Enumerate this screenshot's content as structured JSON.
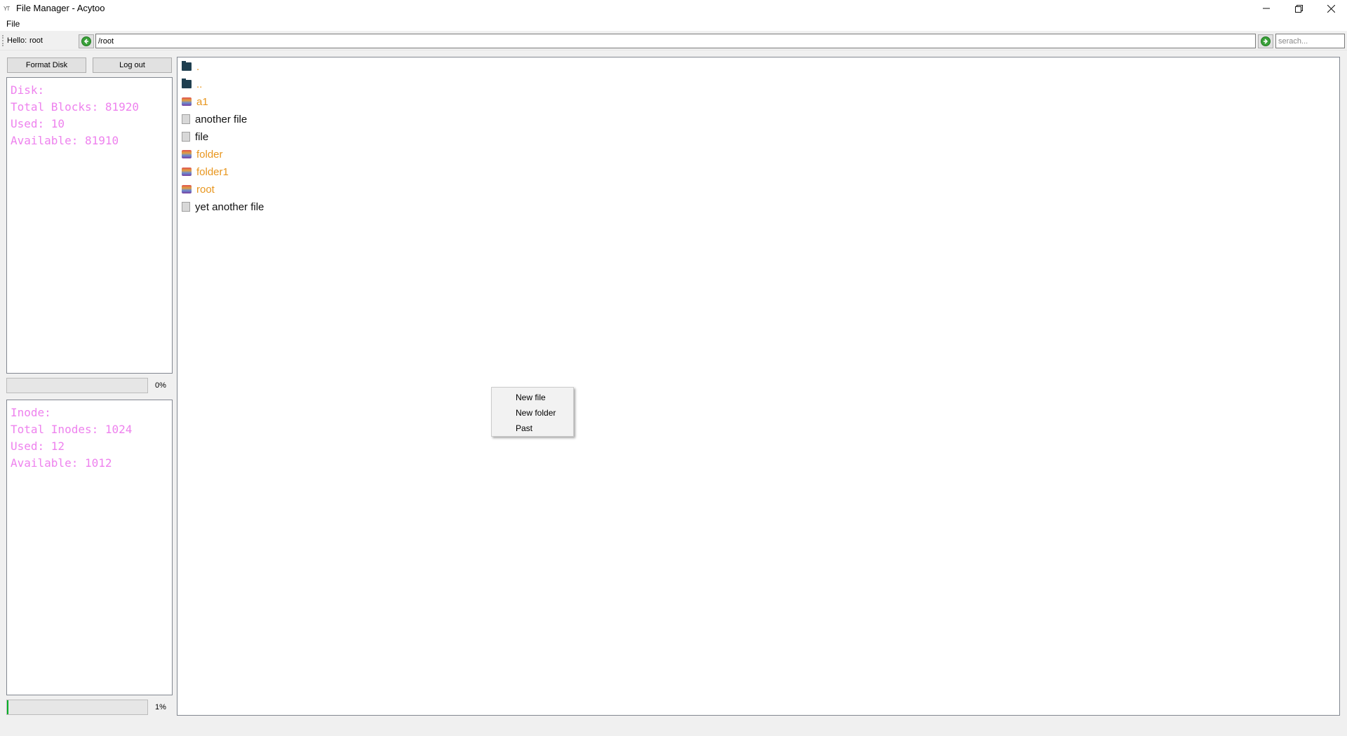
{
  "window": {
    "logo_text": "YT",
    "title": "File Manager - Acytoo",
    "controls": {
      "minimize": "─",
      "maximize": "❐",
      "close": "✕"
    }
  },
  "menu": {
    "file": "File"
  },
  "toolbar": {
    "hello_label": "Hello:",
    "user": "root",
    "path_value": "/root",
    "search_placeholder": "serach..."
  },
  "buttons": {
    "format_disk": "Format Disk",
    "log_out": "Log out"
  },
  "disk": {
    "lines": [
      "Disk:",
      "Total Blocks: 81920",
      "Used: 10",
      "Available: 81910"
    ],
    "progress_percent": 0,
    "progress_text": "0%"
  },
  "inode": {
    "lines": [
      "Inode:",
      "Total Inodes: 1024",
      "Used: 12",
      "Available: 1012"
    ],
    "progress_percent": 1,
    "progress_text": "1%"
  },
  "files": [
    {
      "name": ".",
      "type": "dir-link",
      "icon": "dark-folder-icon"
    },
    {
      "name": "..",
      "type": "dir-link",
      "icon": "dark-folder-icon"
    },
    {
      "name": "a1",
      "type": "folder",
      "icon": "folder-icon"
    },
    {
      "name": "another file",
      "type": "file",
      "icon": "file-icon"
    },
    {
      "name": "file",
      "type": "file",
      "icon": "file-icon"
    },
    {
      "name": "folder",
      "type": "folder",
      "icon": "folder-icon"
    },
    {
      "name": "folder1",
      "type": "folder",
      "icon": "folder-icon"
    },
    {
      "name": "root",
      "type": "folder",
      "icon": "folder-icon"
    },
    {
      "name": "yet another file",
      "type": "file",
      "icon": "file-icon"
    }
  ],
  "context_menu": {
    "items": [
      "New file",
      "New folder",
      "Past"
    ]
  },
  "colors": {
    "info_text": "#ee82ee",
    "folder_name": "#e8961e",
    "progress_fill": "#06b025"
  }
}
